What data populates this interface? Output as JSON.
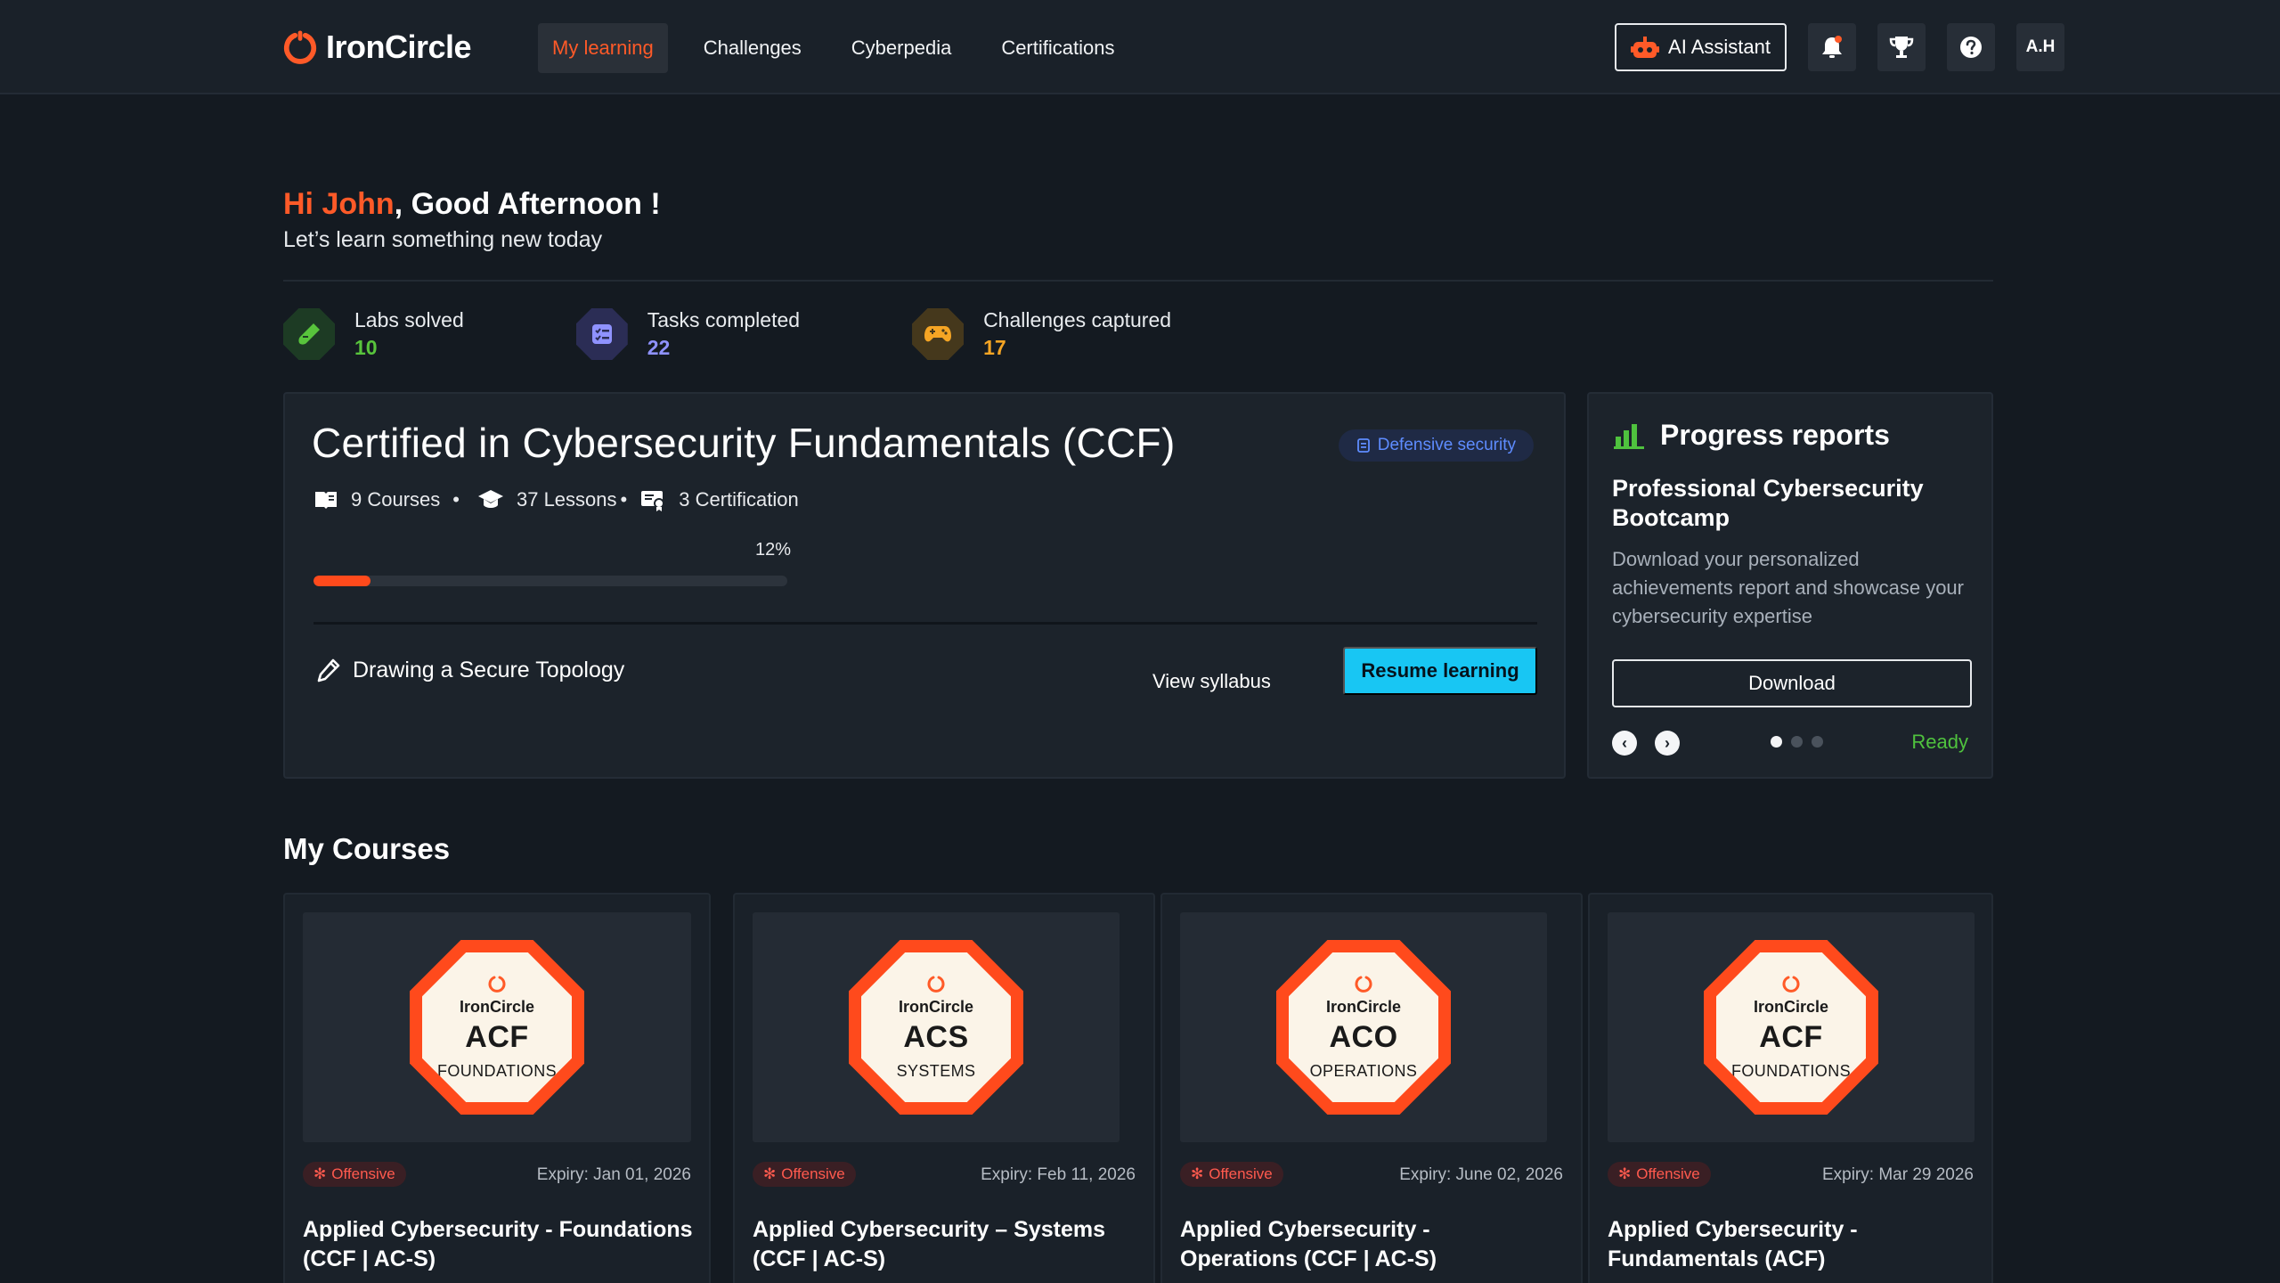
{
  "app": {
    "brand": "IronCircle",
    "colors": {
      "accent": "#ff5a28",
      "cyan": "#18c6f3",
      "green": "#4fc23e",
      "purple": "#8f92ff",
      "amber": "#f5a524"
    }
  },
  "nav": {
    "items": [
      {
        "label": "My learning",
        "active": true
      },
      {
        "label": "Challenges"
      },
      {
        "label": "Cyberpedia"
      },
      {
        "label": "Certifications"
      }
    ],
    "ai_assistant": "AI Assistant",
    "icons": [
      "bell-icon",
      "trophy-icon",
      "help-icon"
    ],
    "avatar": "A.H"
  },
  "greeting": {
    "hi": "Hi John",
    "rest": ", Good Afternoon !",
    "subtitle": "Let’s learn something new today"
  },
  "stats": [
    {
      "label": "Labs solved",
      "value": "10",
      "icon": "flask-icon",
      "color": "#58c43c"
    },
    {
      "label": "Tasks completed",
      "value": "22",
      "icon": "checklist-icon",
      "color": "#8f92ff"
    },
    {
      "label": "Challenges captured",
      "value": "17",
      "icon": "gamepad-icon",
      "color": "#f5a524"
    }
  ],
  "current_course": {
    "title": "Certified in Cybersecurity Fundamentals (CCF)",
    "tag": "Defensive security",
    "courses": "9 Courses",
    "lessons": "37 Lessons",
    "certification": "3 Certification",
    "progress_label": "12%",
    "progress": 0.12,
    "current_lesson": "Drawing a Secure Topology",
    "view_syllabus": "View syllabus",
    "resume": "Resume learning"
  },
  "reports": {
    "title": "Progress reports",
    "subtitle": "Professional Cybersecurity Bootcamp",
    "description": "Download your personalized achievements report and showcase your cybersecurity expertise",
    "download": "Download",
    "status": "Ready",
    "page": 1,
    "pages": 3
  },
  "my_courses": {
    "title": "My Courses",
    "items": [
      {
        "brand": "IronCircle",
        "code": "ACF",
        "kind": "FOUNDATIONS",
        "tag": "Offensive",
        "expiry": "Expiry: Jan 01, 2026",
        "name1": "Applied Cybersecurity - Foundations",
        "name2": "(CCF | AC-S)"
      },
      {
        "brand": "IronCircle",
        "code": "ACS",
        "kind": "SYSTEMS",
        "tag": "Offensive",
        "expiry": "Expiry: Feb 11, 2026",
        "name1": "Applied Cybersecurity – Systems",
        "name2": "(CCF | AC-S)"
      },
      {
        "brand": "IronCircle",
        "code": "ACO",
        "kind": "OPERATIONS",
        "tag": "Offensive",
        "expiry": "Expiry: June 02, 2026",
        "name1": "Applied Cybersecurity -",
        "name2": "Operations  (CCF | AC-S)"
      },
      {
        "brand": "IronCircle",
        "code": "ACF",
        "kind": "FOUNDATIONS",
        "tag": "Offensive",
        "expiry": "Expiry: Mar 29 2026",
        "name1": "Applied Cybersecurity -",
        "name2": "Fundamentals (ACF)"
      }
    ]
  }
}
